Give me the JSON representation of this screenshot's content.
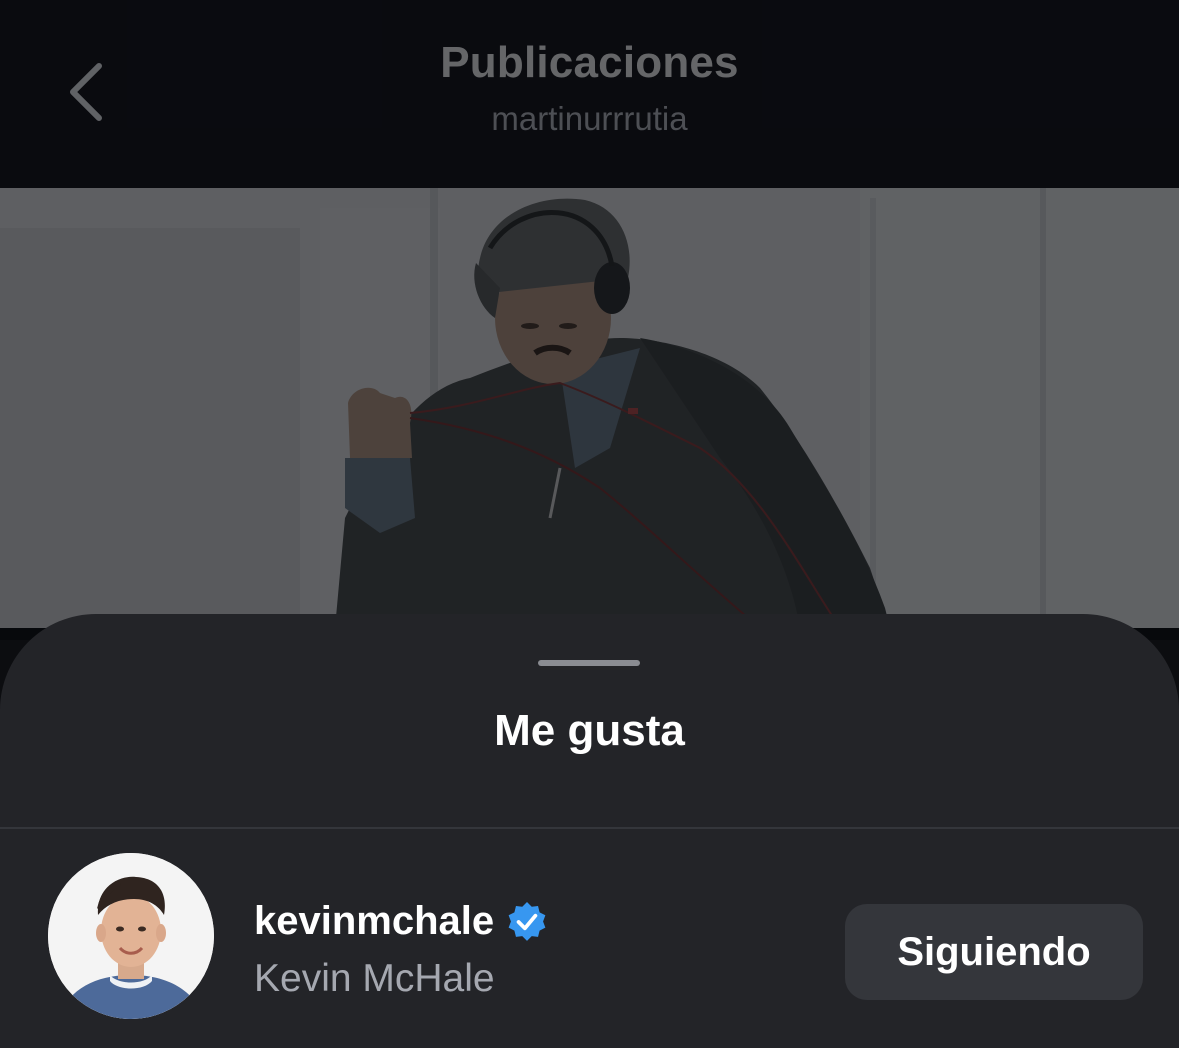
{
  "nav": {
    "title": "Publicaciones",
    "subtitle": "martinurrrutia",
    "back_icon": "chevron-left-icon"
  },
  "post": {
    "image": "photo of young man in backwards cap and headphones, grey hoodie, dancing in a bright white room"
  },
  "likes_sheet": {
    "title": "Me gusta",
    "items": [
      {
        "username": "kevinmchale",
        "full_name": "Kevin McHale",
        "verified": true,
        "verified_icon": "verified-badge-icon",
        "button_label": "Siguiendo"
      }
    ]
  },
  "colors": {
    "sheet_bg": "#232428",
    "verified_blue": "#3797f0",
    "button_bg": "#34363b",
    "secondary_text": "#a5a8b0"
  }
}
